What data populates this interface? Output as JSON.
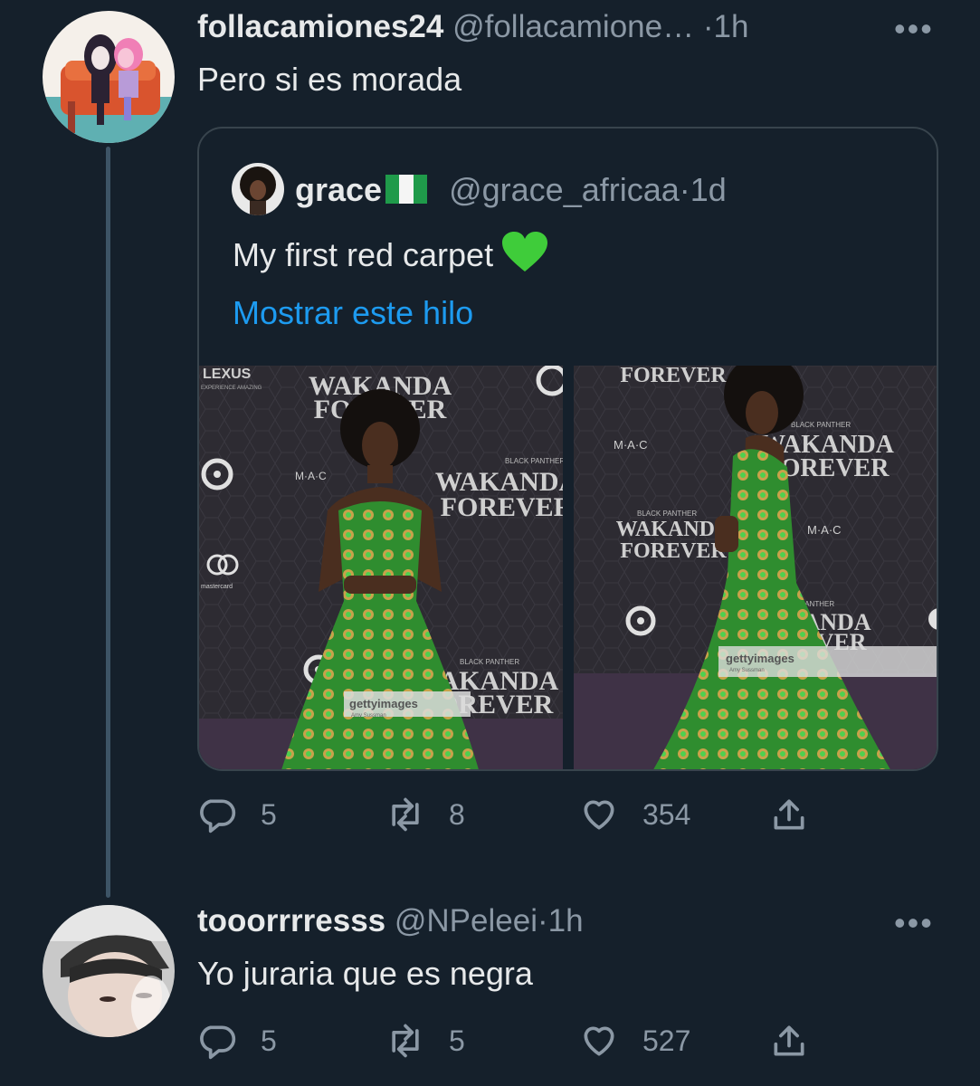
{
  "tweet_1": {
    "display_name": "follacamiones24",
    "handle": "@follacamione…",
    "separator": "·",
    "time": "1h",
    "text": "Pero si es morada",
    "more_icon": "more-icon",
    "quote": {
      "display_name": "grace",
      "flag": "nigeria-flag",
      "handle": "@grace_africaa",
      "separator": "·",
      "time": "1d",
      "text": "My first red carpet",
      "emoji": "green-heart",
      "show_thread": "Mostrar este hilo",
      "photos": [
        {
          "backdrop_text": [
            "WAKANDA",
            "FOREVER"
          ],
          "sponsor_text": [
            "LEXUS",
            "EXPERIENCE AMAZING",
            "mastercard",
            "M·A·C",
            "BLACK PANTHER"
          ],
          "watermark": "gettyimages",
          "credit": "Amy Sussman"
        },
        {
          "backdrop_text": [
            "WAKANDA",
            "FOREVER"
          ],
          "sponsor_text": [
            "M·A·C",
            "BLACK PANTHER"
          ],
          "watermark": "gettyimages",
          "credit": "Amy Sussman"
        }
      ]
    },
    "actions": {
      "replies": "5",
      "retweets": "8",
      "likes": "354"
    }
  },
  "tweet_2": {
    "display_name": "tooorrrresss",
    "handle": "@NPeleei",
    "separator": "·",
    "time": "1h",
    "text": "Yo juraria que es negra",
    "more_icon": "more-icon",
    "actions": {
      "replies": "5",
      "retweets": "5",
      "likes": "527"
    }
  },
  "colors": {
    "background": "#15202b",
    "text": "#e7e9ea",
    "secondary": "#8b98a5",
    "link": "#1d9bf0",
    "border": "#38444d"
  }
}
